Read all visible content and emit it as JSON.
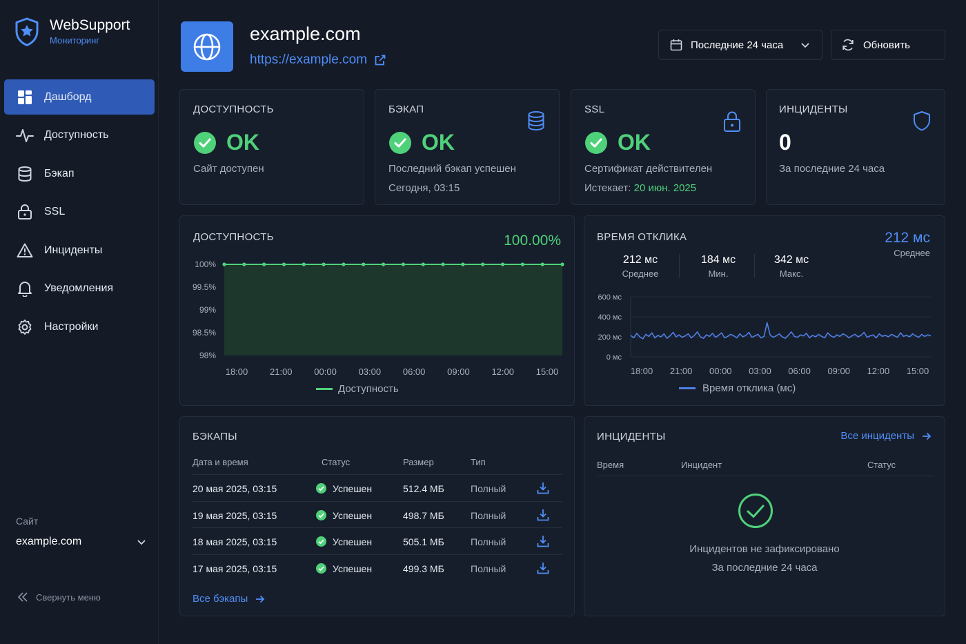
{
  "app": {
    "name": "WebSupport",
    "subtitle": "Мониторинг"
  },
  "sidebar": {
    "items": [
      {
        "label": "Дашборд",
        "icon": "dashboard-icon",
        "active": true
      },
      {
        "label": "Доступность",
        "icon": "pulse-icon"
      },
      {
        "label": "Бэкап",
        "icon": "database-icon"
      },
      {
        "label": "SSL",
        "icon": "lock-icon"
      },
      {
        "label": "Инциденты",
        "icon": "warning-icon"
      },
      {
        "label": "Уведомления",
        "icon": "bell-icon"
      },
      {
        "label": "Настройки",
        "icon": "gear-icon"
      }
    ],
    "site_label": "Сайт",
    "site_value": "example.com",
    "collapse_label": "Свернуть меню"
  },
  "header": {
    "domain": "example.com",
    "url": "https://example.com",
    "range": "Последние 24 часа",
    "refresh": "Обновить"
  },
  "cards": {
    "availability": {
      "title": "ДОСТУПНОСТЬ",
      "status": "OK",
      "desc": "Сайт доступен"
    },
    "backup": {
      "title": "БЭКАП",
      "status": "OK",
      "desc": "Последний бэкап успешен",
      "time": "Сегодня, 03:15"
    },
    "ssl": {
      "title": "SSL",
      "status": "OK",
      "desc": "Сертификат действителен",
      "expires_label": "Истекает:",
      "expires_value": "20 июн. 2025"
    },
    "incidents": {
      "title": "ИНЦИДЕНТЫ",
      "count": "0",
      "desc": "За последние 24 часа"
    }
  },
  "availability_chart": {
    "title": "ДОСТУПНОСТЬ",
    "value": "100.00%",
    "legend": "Доступность"
  },
  "response_chart": {
    "title": "ВРЕМЯ ОТКЛИКА",
    "value": "212 мс",
    "value_label": "Среднее",
    "stats": [
      {
        "value": "212 мс",
        "label": "Среднее"
      },
      {
        "value": "184 мс",
        "label": "Мин."
      },
      {
        "value": "342 мс",
        "label": "Макс."
      }
    ],
    "legend": "Время отклика (мс)"
  },
  "backups": {
    "title": "БЭКАПЫ",
    "columns": [
      "Дата и время",
      "Статус",
      "Размер",
      "Тип"
    ],
    "rows": [
      {
        "date": "20 мая 2025, 03:15",
        "status": "Успешен",
        "size": "512.4 МБ",
        "type": "Полный"
      },
      {
        "date": "19 мая 2025, 03:15",
        "status": "Успешен",
        "size": "498.7 МБ",
        "type": "Полный"
      },
      {
        "date": "18 мая 2025, 03:15",
        "status": "Успешен",
        "size": "505.1 МБ",
        "type": "Полный"
      },
      {
        "date": "17 мая 2025, 03:15",
        "status": "Успешен",
        "size": "499.3 МБ",
        "type": "Полный"
      }
    ],
    "all_link": "Все бэкапы"
  },
  "incidents": {
    "title": "ИНЦИДЕНТЫ",
    "all_link": "Все инциденты",
    "columns": [
      "Время",
      "Инцидент",
      "Статус"
    ],
    "empty_title": "Инцидентов не зафиксировано",
    "empty_sub": "За последние 24 часа"
  },
  "colors": {
    "accent": "#3f7de6",
    "ok": "#4fd17a",
    "link": "#4f8ef7",
    "bg": "#141a26",
    "card": "#171e2b"
  },
  "chart_data": [
    {
      "type": "area",
      "title": "ДОСТУПНОСТЬ",
      "x": [
        "18:00",
        "21:00",
        "00:00",
        "03:00",
        "06:00",
        "09:00",
        "12:00",
        "15:00"
      ],
      "yticks": [
        "100%",
        "99.5%",
        "99%",
        "98.5%",
        "98%"
      ],
      "ylim": [
        98,
        100
      ],
      "series": [
        {
          "name": "Доступность",
          "values": [
            100,
            100,
            100,
            100,
            100,
            100,
            100,
            100,
            100,
            100,
            100,
            100,
            100,
            100,
            100,
            100,
            100,
            100
          ]
        }
      ],
      "legend": "bottom"
    },
    {
      "type": "line",
      "title": "ВРЕМЯ ОТКЛИКА",
      "x": [
        "18:00",
        "21:00",
        "00:00",
        "03:00",
        "06:00",
        "09:00",
        "12:00",
        "15:00"
      ],
      "yticks": [
        "600 мс",
        "400 мс",
        "200 мс",
        "0 мс"
      ],
      "ylim": [
        0,
        600
      ],
      "series": [
        {
          "name": "Время отклика (мс)",
          "values": [
            215,
            190,
            235,
            200,
            180,
            225,
            205,
            240,
            190,
            215,
            200,
            230,
            185,
            210,
            245,
            200,
            220,
            195,
            210,
            230,
            190,
            215,
            250,
            200,
            185,
            220,
            205,
            235,
            195,
            215,
            240,
            190,
            205,
            225,
            210,
            190,
            230,
            200,
            215,
            245,
            195,
            210,
            225,
            190,
            205,
            342,
            220,
            195,
            210,
            230,
            200,
            185,
            215,
            250,
            205,
            195,
            220,
            210,
            235,
            190,
            215,
            200,
            225,
            205,
            190,
            240,
            210,
            195,
            220,
            205,
            230,
            215,
            190,
            210,
            225,
            200,
            215,
            245,
            195,
            210,
            220,
            190,
            230,
            205,
            215,
            200,
            225,
            210,
            195,
            240,
            205,
            215,
            200,
            230,
            210,
            195,
            225,
            205,
            220,
            210
          ]
        }
      ],
      "legend": "bottom"
    }
  ]
}
